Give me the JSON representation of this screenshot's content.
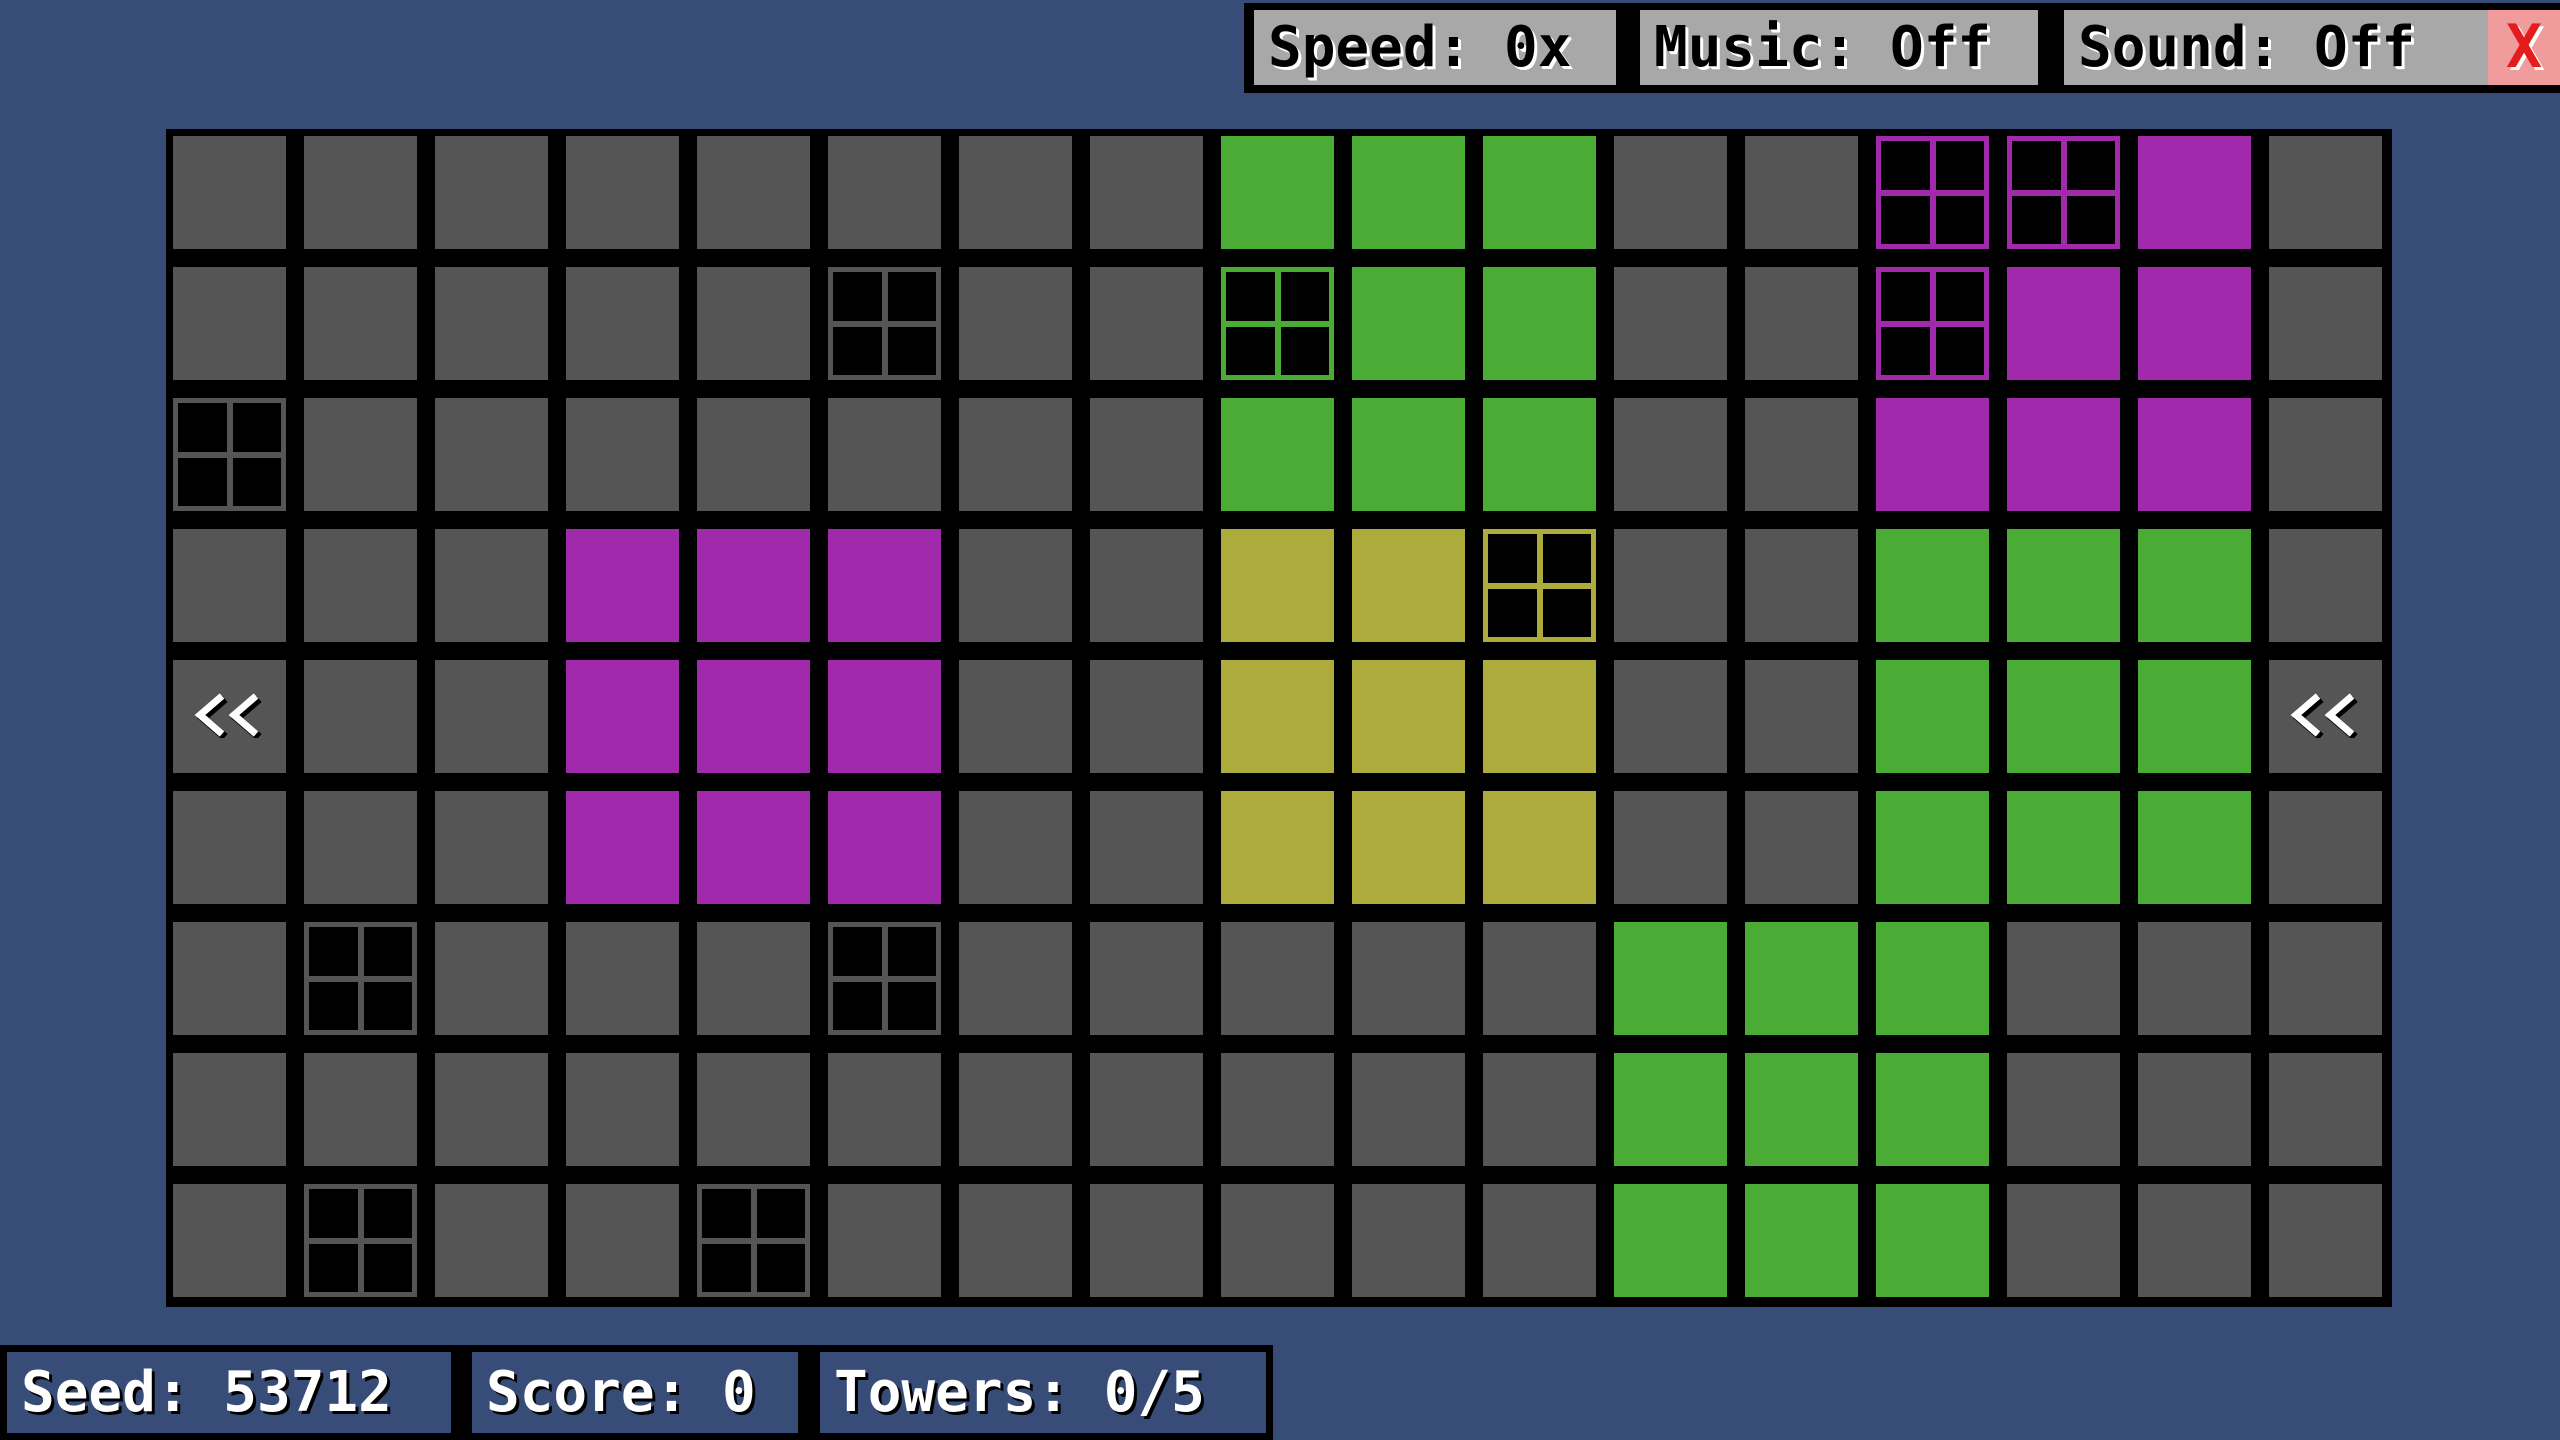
{
  "toolbar": {
    "speed_label": "Speed: 0x",
    "music_label": "Music: Off",
    "sound_label": "Sound: Off",
    "close_label": "X"
  },
  "status": {
    "seed_label": "Seed: 53712",
    "score_label": "Score: 0",
    "towers_label": "Towers: 0/5"
  },
  "colors": {
    "background": "#384c78",
    "empty": "#555555",
    "green": "#4aab35",
    "purple": "#a12aac",
    "yellow": "#acab3b",
    "button": "#a8a8a8",
    "close_button": "#f19c9c",
    "close_text": "#e41c1c"
  },
  "legend": {
    "E": "empty",
    "G": "green",
    "P": "purple",
    "Y": "yellow",
    "t": "tower",
    "A": "arrow-left"
  },
  "board": {
    "columns": 17,
    "rows": [
      [
        "E",
        "E",
        "E",
        "E",
        "E",
        "E",
        "E",
        "E",
        "G",
        "G",
        "G",
        "E",
        "E",
        "Pt",
        "Pt",
        "P",
        "E"
      ],
      [
        "E",
        "E",
        "E",
        "E",
        "E",
        "Et",
        "E",
        "E",
        "Gt",
        "G",
        "G",
        "E",
        "E",
        "Pt",
        "P",
        "P",
        "E"
      ],
      [
        "Et",
        "E",
        "E",
        "E",
        "E",
        "E",
        "E",
        "E",
        "G",
        "G",
        "G",
        "E",
        "E",
        "P",
        "P",
        "P",
        "E"
      ],
      [
        "E",
        "E",
        "E",
        "P",
        "P",
        "P",
        "E",
        "E",
        "Y",
        "Y",
        "Yt",
        "E",
        "E",
        "G",
        "G",
        "G",
        "E"
      ],
      [
        "EA",
        "E",
        "E",
        "P",
        "P",
        "P",
        "E",
        "E",
        "Y",
        "Y",
        "Y",
        "E",
        "E",
        "G",
        "G",
        "G",
        "EA"
      ],
      [
        "E",
        "E",
        "E",
        "P",
        "P",
        "P",
        "E",
        "E",
        "Y",
        "Y",
        "Y",
        "E",
        "E",
        "G",
        "G",
        "G",
        "E"
      ],
      [
        "E",
        "Et",
        "E",
        "E",
        "E",
        "Et",
        "E",
        "E",
        "E",
        "E",
        "E",
        "G",
        "G",
        "G",
        "E",
        "E",
        "E"
      ],
      [
        "E",
        "E",
        "E",
        "E",
        "E",
        "E",
        "E",
        "E",
        "E",
        "E",
        "E",
        "G",
        "G",
        "G",
        "E",
        "E",
        "E"
      ],
      [
        "E",
        "Et",
        "E",
        "E",
        "Et",
        "E",
        "E",
        "E",
        "E",
        "E",
        "E",
        "G",
        "G",
        "G",
        "E",
        "E",
        "E"
      ]
    ]
  }
}
